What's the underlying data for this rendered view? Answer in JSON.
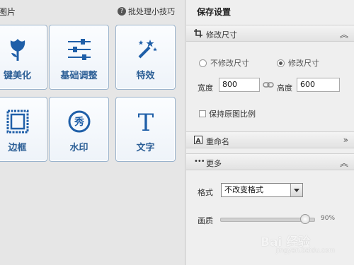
{
  "left_panel": {
    "title": "图片",
    "tips_label": "批处理小技巧",
    "tiles": [
      {
        "label": "键美化",
        "icon": "tulip-icon"
      },
      {
        "label": "基础调整",
        "icon": "sliders-icon"
      },
      {
        "label": "特效",
        "icon": "magic-wand-icon"
      },
      {
        "label": "边框",
        "icon": "frame-icon"
      },
      {
        "label": "水印",
        "icon": "watermark-icon"
      },
      {
        "label": "文字",
        "icon": "text-icon"
      }
    ]
  },
  "right_panel": {
    "title": "保存设置",
    "resize": {
      "header": "修改尺寸",
      "option_keep": "不修改尺寸",
      "option_resize": "修改尺寸",
      "selected": "修改尺寸",
      "width_label": "宽度",
      "width_value": "800",
      "height_label": "高度",
      "height_value": "600",
      "keep_ratio_label": "保持原图比例",
      "keep_ratio_checked": false
    },
    "rename": {
      "header": "重命名"
    },
    "more": {
      "header": "更多",
      "format_label": "格式",
      "format_value": "不改变格式",
      "quality_label": "画质",
      "quality_value": "90%",
      "quality_fraction": 0.9
    }
  },
  "watermark": {
    "text": "Bai 经验",
    "sub": "jingyan.baidu.com"
  },
  "colors": {
    "accent": "#2c5f96",
    "icon_blue": "#1f5fa8"
  }
}
